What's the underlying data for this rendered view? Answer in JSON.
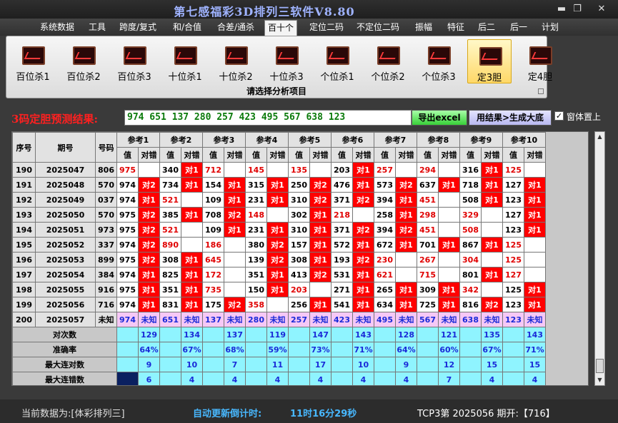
{
  "window": {
    "title": "第七感福彩3D排列三软件V8.80",
    "min_icon": "minimize-icon",
    "max_icon": "restore-icon",
    "close_icon": "close-icon"
  },
  "menu": [
    "系统数据",
    "工具",
    "跨度/复式",
    "和/合值",
    "合差/通杀",
    "百十个",
    "定位二码",
    "不定位二码",
    "振幅",
    "特征",
    "后二",
    "后一",
    "计划"
  ],
  "active_menu": "百十个",
  "toolbar": {
    "buttons": [
      "百位杀1",
      "百位杀2",
      "百位杀3",
      "十位杀1",
      "十位杀2",
      "十位杀3",
      "个位杀1",
      "个位杀2",
      "个位杀3",
      "定3胆",
      "定4胆"
    ],
    "selected": "定3胆",
    "caption": "请选择分析项目"
  },
  "prediction": {
    "label": "3码定胆预测结果:",
    "value": "974 651 137 280 257 423 495 567 638 123",
    "export_label": "导出excel",
    "generate_label": "用结果>生成大底",
    "ontop_label": "窗体置上",
    "ontop_checked": "✓"
  },
  "table": {
    "col_headers": [
      "序号",
      "期号",
      "号码"
    ],
    "ref_headers": [
      "参考1",
      "参考2",
      "参考3",
      "参考4",
      "参考5",
      "参考6",
      "参考7",
      "参考8",
      "参考9",
      "参考10"
    ],
    "sub_headers": [
      "值",
      "对错"
    ],
    "rows": [
      {
        "seq": "190",
        "issue": "2025047",
        "num": "806",
        "cells": [
          [
            "975",
            "r",
            ""
          ],
          [
            "340",
            "b",
            "对1"
          ],
          [
            "712",
            "r",
            ""
          ],
          [
            "145",
            "r",
            ""
          ],
          [
            "135",
            "r",
            ""
          ],
          [
            "203",
            "b",
            "对1"
          ],
          [
            "257",
            "r",
            ""
          ],
          [
            "294",
            "r",
            ""
          ],
          [
            "316",
            "b",
            "对1"
          ],
          [
            "125",
            "r",
            ""
          ]
        ]
      },
      {
        "seq": "191",
        "issue": "2025048",
        "num": "570",
        "cells": [
          [
            "974",
            "b",
            "对2"
          ],
          [
            "734",
            "b",
            "对1"
          ],
          [
            "154",
            "b",
            "对1"
          ],
          [
            "315",
            "b",
            "对1"
          ],
          [
            "250",
            "b",
            "对2"
          ],
          [
            "476",
            "b",
            "对1"
          ],
          [
            "573",
            "b",
            "对2"
          ],
          [
            "637",
            "b",
            "对1"
          ],
          [
            "718",
            "b",
            "对1"
          ],
          [
            "127",
            "b",
            "对1"
          ]
        ]
      },
      {
        "seq": "192",
        "issue": "2025049",
        "num": "037",
        "cells": [
          [
            "974",
            "b",
            "对1"
          ],
          [
            "521",
            "r",
            ""
          ],
          [
            "109",
            "b",
            "对1"
          ],
          [
            "231",
            "b",
            "对1"
          ],
          [
            "310",
            "b",
            "对2"
          ],
          [
            "371",
            "b",
            "对2"
          ],
          [
            "394",
            "b",
            "对1"
          ],
          [
            "451",
            "r",
            ""
          ],
          [
            "508",
            "b",
            "对1"
          ],
          [
            "123",
            "b",
            "对1"
          ]
        ]
      },
      {
        "seq": "193",
        "issue": "2025050",
        "num": "570",
        "cells": [
          [
            "975",
            "b",
            "对2"
          ],
          [
            "385",
            "b",
            "对1"
          ],
          [
            "708",
            "b",
            "对2"
          ],
          [
            "148",
            "r",
            ""
          ],
          [
            "302",
            "b",
            "对1"
          ],
          [
            "218",
            "r",
            ""
          ],
          [
            "258",
            "b",
            "对1"
          ],
          [
            "298",
            "r",
            ""
          ],
          [
            "329",
            "r",
            ""
          ],
          [
            "127",
            "b",
            "对1"
          ]
        ]
      },
      {
        "seq": "194",
        "issue": "2025051",
        "num": "973",
        "cells": [
          [
            "975",
            "b",
            "对2"
          ],
          [
            "521",
            "r",
            ""
          ],
          [
            "109",
            "b",
            "对1"
          ],
          [
            "231",
            "b",
            "对1"
          ],
          [
            "310",
            "b",
            "对1"
          ],
          [
            "371",
            "b",
            "对2"
          ],
          [
            "394",
            "b",
            "对2"
          ],
          [
            "451",
            "r",
            ""
          ],
          [
            "508",
            "r",
            ""
          ],
          [
            "123",
            "b",
            "对1"
          ]
        ]
      },
      {
        "seq": "195",
        "issue": "2025052",
        "num": "337",
        "cells": [
          [
            "974",
            "b",
            "对2"
          ],
          [
            "890",
            "r",
            ""
          ],
          [
            "186",
            "r",
            ""
          ],
          [
            "380",
            "b",
            "对2"
          ],
          [
            "157",
            "b",
            "对1"
          ],
          [
            "572",
            "b",
            "对1"
          ],
          [
            "672",
            "b",
            "对1"
          ],
          [
            "701",
            "b",
            "对1"
          ],
          [
            "867",
            "b",
            "对1"
          ],
          [
            "125",
            "r",
            ""
          ]
        ]
      },
      {
        "seq": "196",
        "issue": "2025053",
        "num": "899",
        "cells": [
          [
            "975",
            "b",
            "对2"
          ],
          [
            "308",
            "b",
            "对1"
          ],
          [
            "645",
            "r",
            ""
          ],
          [
            "139",
            "b",
            "对2"
          ],
          [
            "308",
            "b",
            "对1"
          ],
          [
            "193",
            "b",
            "对2"
          ],
          [
            "230",
            "r",
            ""
          ],
          [
            "267",
            "r",
            ""
          ],
          [
            "304",
            "r",
            ""
          ],
          [
            "125",
            "r",
            ""
          ]
        ]
      },
      {
        "seq": "197",
        "issue": "2025054",
        "num": "384",
        "cells": [
          [
            "974",
            "b",
            "对1"
          ],
          [
            "825",
            "b",
            "对1"
          ],
          [
            "172",
            "r",
            ""
          ],
          [
            "351",
            "b",
            "对1"
          ],
          [
            "413",
            "b",
            "对2"
          ],
          [
            "531",
            "b",
            "对1"
          ],
          [
            "621",
            "r",
            ""
          ],
          [
            "715",
            "r",
            ""
          ],
          [
            "801",
            "b",
            "对1"
          ],
          [
            "127",
            "r",
            ""
          ]
        ]
      },
      {
        "seq": "198",
        "issue": "2025055",
        "num": "916",
        "cells": [
          [
            "975",
            "b",
            "对1"
          ],
          [
            "351",
            "b",
            "对1"
          ],
          [
            "735",
            "r",
            ""
          ],
          [
            "150",
            "b",
            "对1"
          ],
          [
            "203",
            "r",
            ""
          ],
          [
            "271",
            "b",
            "对1"
          ],
          [
            "265",
            "b",
            "对1"
          ],
          [
            "309",
            "b",
            "对1"
          ],
          [
            "342",
            "r",
            ""
          ],
          [
            "125",
            "b",
            "对1"
          ]
        ]
      },
      {
        "seq": "199",
        "issue": "2025056",
        "num": "716",
        "cells": [
          [
            "974",
            "b",
            "对1"
          ],
          [
            "831",
            "b",
            "对1"
          ],
          [
            "175",
            "b",
            "对2"
          ],
          [
            "358",
            "r",
            ""
          ],
          [
            "256",
            "b",
            "对1"
          ],
          [
            "541",
            "b",
            "对1"
          ],
          [
            "634",
            "b",
            "对1"
          ],
          [
            "725",
            "b",
            "对1"
          ],
          [
            "816",
            "b",
            "对2"
          ],
          [
            "123",
            "b",
            "对1"
          ]
        ]
      }
    ],
    "predict_row": {
      "seq": "200",
      "issue": "2025057",
      "num": "未知",
      "cells": [
        [
          "974",
          "未知"
        ],
        [
          "651",
          "未知"
        ],
        [
          "137",
          "未知"
        ],
        [
          "280",
          "未知"
        ],
        [
          "257",
          "未知"
        ],
        [
          "423",
          "未知"
        ],
        [
          "495",
          "未知"
        ],
        [
          "567",
          "未知"
        ],
        [
          "638",
          "未知"
        ],
        [
          "123",
          "未知"
        ]
      ]
    },
    "stats": [
      {
        "label": "对次数",
        "values": [
          "129",
          "134",
          "137",
          "119",
          "147",
          "143",
          "128",
          "121",
          "135",
          "143"
        ]
      },
      {
        "label": "准确率",
        "values": [
          "64%",
          "67%",
          "68%",
          "59%",
          "73%",
          "71%",
          "64%",
          "60%",
          "67%",
          "71%"
        ]
      },
      {
        "label": "最大连对数",
        "values": [
          "9",
          "10",
          "7",
          "11",
          "17",
          "10",
          "9",
          "12",
          "15",
          "15"
        ]
      },
      {
        "label": "最大连错数",
        "values": [
          "6",
          "4",
          "4",
          "4",
          "4",
          "4",
          "4",
          "7",
          "4",
          "4"
        ]
      }
    ]
  },
  "status": {
    "data_source": "当前数据为:[体彩排列三]",
    "countdown_label": "自动更新倒计时:",
    "countdown_value": "11时16分29秒",
    "latest": "TCP3第 2025056 期开:【716】"
  },
  "colors": {
    "hit": "#ff0000",
    "miss_text": "#e00000",
    "stat_bg": "#8ff4ff",
    "predict_bg": "#f6c8f6"
  }
}
